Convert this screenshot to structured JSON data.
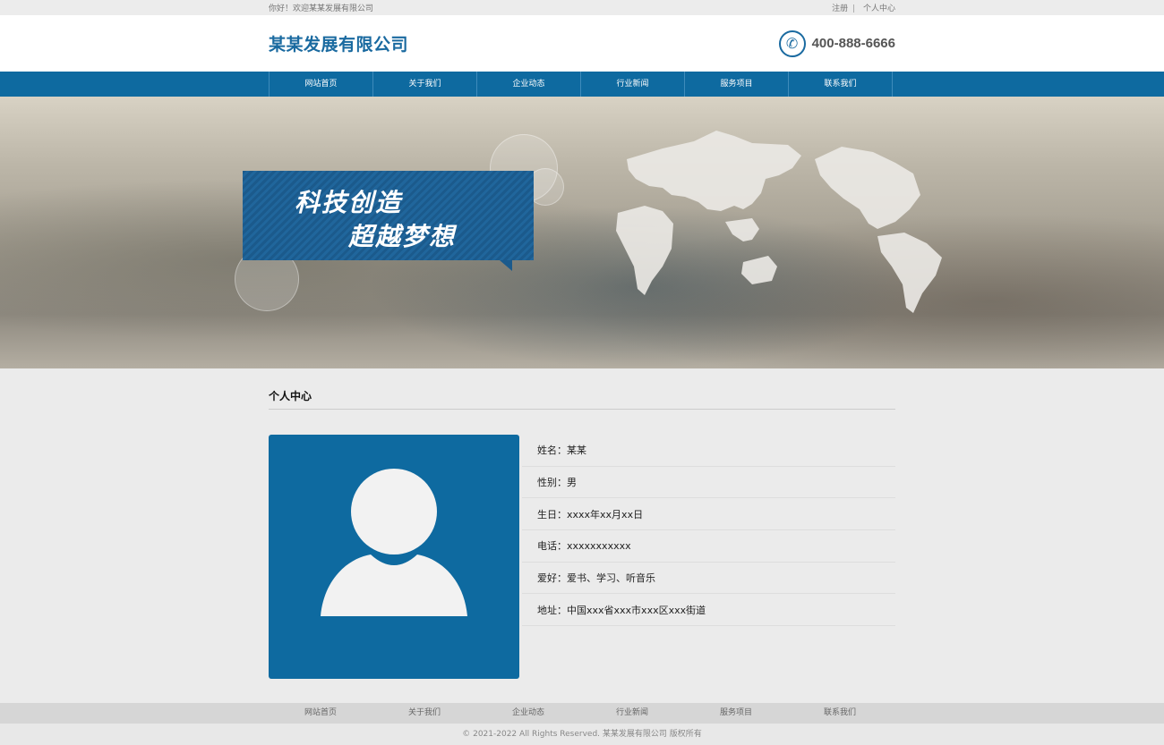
{
  "topbar": {
    "welcome": "你好！欢迎某某发展有限公司",
    "register": "注册",
    "separator": "|",
    "profile_link": "个人中心"
  },
  "header": {
    "logo": "某某发展有限公司",
    "phone_icon": "phone-icon",
    "phone": "400-888-6666"
  },
  "nav": {
    "items": [
      {
        "label": "网站首页"
      },
      {
        "label": "关于我们"
      },
      {
        "label": "企业动态"
      },
      {
        "label": "行业新闻"
      },
      {
        "label": "服务项目"
      },
      {
        "label": "联系我们"
      }
    ]
  },
  "banner": {
    "slogan_line1": "科技创造",
    "slogan_line2": "超越梦想"
  },
  "profile": {
    "section_title": "个人中心",
    "avatar_icon": "user-avatar-icon",
    "fields": [
      {
        "label": "姓名：",
        "value": "某某"
      },
      {
        "label": "性别：",
        "value": "男"
      },
      {
        "label": "生日：",
        "value": "xxxx年xx月xx日"
      },
      {
        "label": "电话：",
        "value": "xxxxxxxxxxx"
      },
      {
        "label": "爱好：",
        "value": "爱书、学习、听音乐"
      },
      {
        "label": "地址：",
        "value": "中国xxx省xxx市xxx区xxx街道"
      }
    ]
  },
  "footer": {
    "links": [
      {
        "label": "网站首页"
      },
      {
        "label": "关于我们"
      },
      {
        "label": "企业动态"
      },
      {
        "label": "行业新闻"
      },
      {
        "label": "服务项目"
      },
      {
        "label": "联系我们"
      }
    ],
    "copyright": "© 2021-2022 All Rights Reserved. 某某发展有限公司 版权所有"
  },
  "colors": {
    "brand_blue": "#0e6aa0",
    "background": "#ebebeb"
  }
}
